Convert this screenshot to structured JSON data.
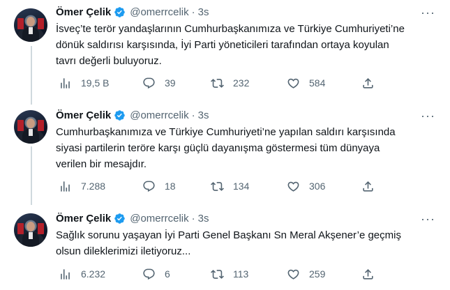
{
  "tweets": [
    {
      "name": "Ömer Çelik",
      "handle": "@omerrcelik",
      "separator": "·",
      "time": "3s",
      "text_lines": [
        "İsveç’te terör yandaşlarının Cumhurbaşkanımıza ve Türkiye Cumhuriyeti’ne",
        "dönük saldırısı karşısında, İyi Parti yöneticileri tarafından ortaya koyulan",
        "tavrı değerli buluyoruz."
      ],
      "views": "19,5 B",
      "replies": "39",
      "retweets": "232",
      "likes": "584"
    },
    {
      "name": "Ömer Çelik",
      "handle": "@omerrcelik",
      "separator": "·",
      "time": "3s",
      "text_lines": [
        "Cumhurbaşkanımıza ve Türkiye Cumhuriyeti’ne yapılan saldırı karşısında",
        "siyasi partilerin teröre karşı güçlü dayanışma göstermesi tüm dünyaya",
        "verilen bir mesajdır."
      ],
      "views": "7.288",
      "replies": "18",
      "retweets": "134",
      "likes": "306"
    },
    {
      "name": "Ömer Çelik",
      "handle": "@omerrcelik",
      "separator": "·",
      "time": "3s",
      "text_lines": [
        "Sağlık sorunu yaşayan İyi Parti Genel Başkanı Sn Meral Akşener’e geçmiş",
        "olsun dileklerimizi iletiyoruz..."
      ],
      "views": "6.232",
      "replies": "6",
      "retweets": "113",
      "likes": "259"
    }
  ],
  "icons": {
    "views": "bar-chart-icon",
    "reply": "speech-bubble-icon",
    "retweet": "retweet-arrows-icon",
    "like": "heart-icon",
    "share": "share-upload-icon",
    "verified": "verified-badge-icon",
    "more": "ellipsis-icon"
  },
  "colors": {
    "text": "#0f1419",
    "secondary": "#536471",
    "verified": "#1d9bf0",
    "divider": "#eff3f4",
    "thread_line": "#cfd9de"
  }
}
